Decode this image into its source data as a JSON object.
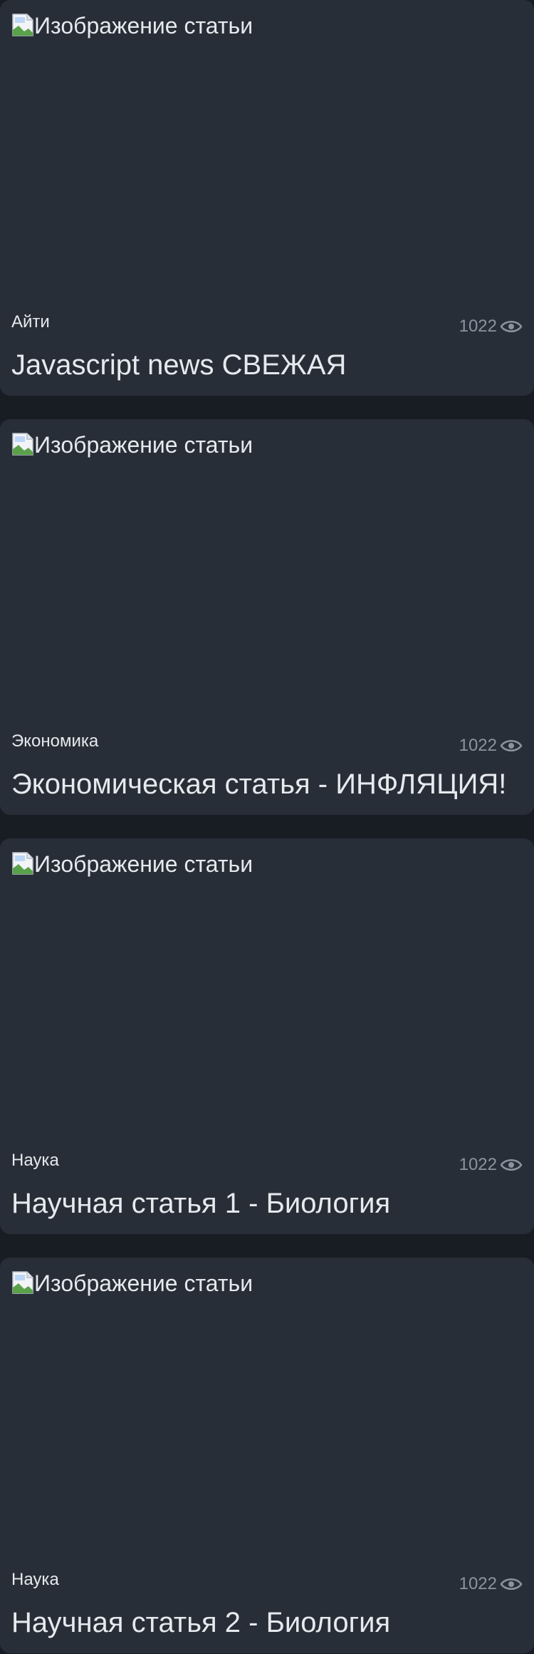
{
  "image_alt": "Изображение статьи",
  "colors": {
    "page_background": "#181c23",
    "card_background": "#282e37",
    "text_primary": "#e6e9ee",
    "text_muted": "#8a93a0"
  },
  "articles": [
    {
      "category": "Айти",
      "views": "1022",
      "title": "Javascript news СВЕЖАЯ"
    },
    {
      "category": "Экономика",
      "views": "1022",
      "title": "Экономическая статья - ИНФЛЯЦИЯ!"
    },
    {
      "category": "Наука",
      "views": "1022",
      "title": "Научная статья 1 - Биология"
    },
    {
      "category": "Наука",
      "views": "1022",
      "title": "Научная статья 2 - Биология"
    }
  ]
}
